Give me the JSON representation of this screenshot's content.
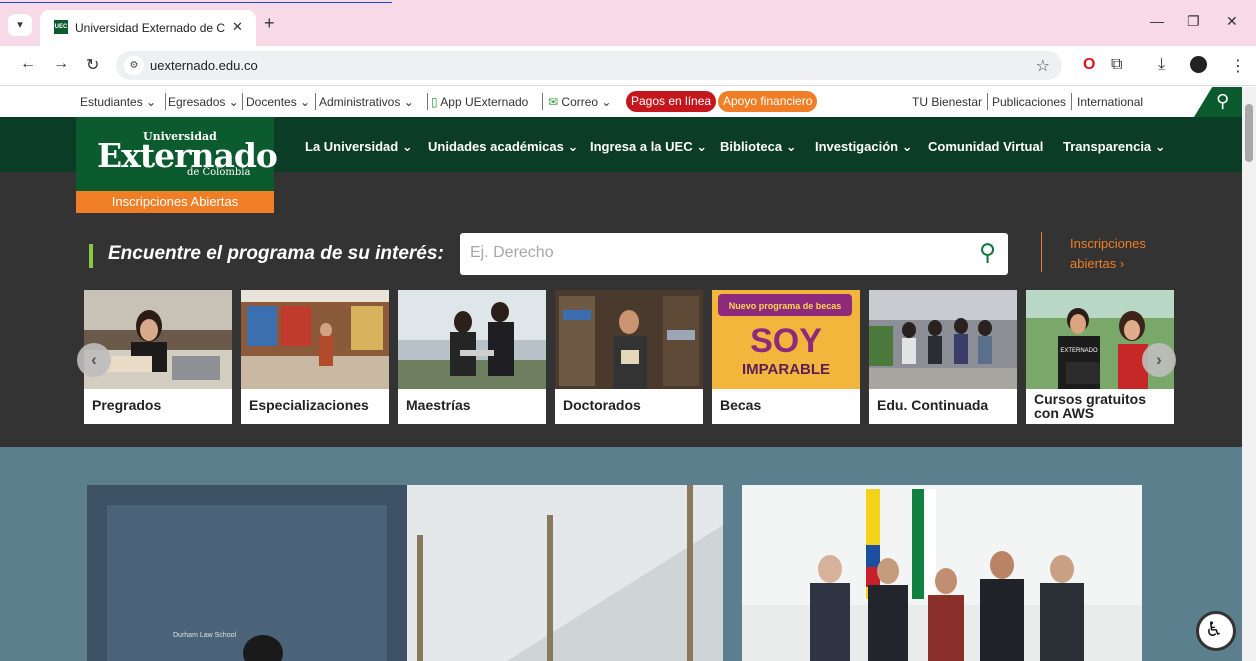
{
  "browser": {
    "tab_title": "Universidad Externado de Colon",
    "tab_favicon": "UEC",
    "url": "uexternado.edu.co",
    "icons": [
      "back-icon",
      "forward-icon",
      "reload-icon",
      "site-settings-icon",
      "bookmark-star-icon",
      "opera-icon",
      "extensions-icon",
      "download-icon",
      "profile-icon",
      "more-icon"
    ]
  },
  "util_bar": {
    "estudiantes": "Estudiantes",
    "egresados": "Egresados",
    "docentes": "Docentes",
    "administrativos": "Administrativos",
    "app": "App UExternado",
    "correo": "Correo",
    "pagos": "Pagos en línea",
    "apoyo": "Apoyo financiero",
    "bienestar": "TU Bienestar",
    "publicaciones": "Publicaciones",
    "international": "International"
  },
  "logo": {
    "top": "Universidad",
    "main": "Externado",
    "sub": "de Colombia",
    "tag": "Inscripciones Abiertas"
  },
  "nav": {
    "universidad": "La Universidad",
    "unidades": "Unidades académicas",
    "ingresa": "Ingresa a la UEC",
    "biblioteca": "Biblioteca",
    "investigacion": "Investigación",
    "comunidad": "Comunidad Virtual",
    "transparencia": "Transparencia"
  },
  "program_search": {
    "label": "Encuentre el programa de su interés:",
    "placeholder": "Ej. Derecho",
    "link_line1": "Inscripciones",
    "link_line2": "abiertas"
  },
  "programs": [
    {
      "label": "Pregrados"
    },
    {
      "label": "Especializaciones"
    },
    {
      "label": "Maestrías"
    },
    {
      "label": "Doctorados"
    },
    {
      "label": "Becas",
      "banner_line1": "Nuevo programa de becas",
      "banner_line2": "SOY",
      "banner_line3": "IMPARABLE"
    },
    {
      "label": "Edu. Continuada"
    },
    {
      "label1": "Cursos gratuitos",
      "label2": "con AWS",
      "shirt": "EXTERNADO"
    }
  ],
  "news_image_text": "Durham Law School",
  "colors": {
    "brand_green": "#0c5b2f",
    "nav_green": "#0b3d26",
    "accent_orange": "#f07e26",
    "pay_red": "#c4171d",
    "dark_band": "#333333",
    "news_band": "#5b7f8c",
    "lime": "#8dc63f"
  }
}
